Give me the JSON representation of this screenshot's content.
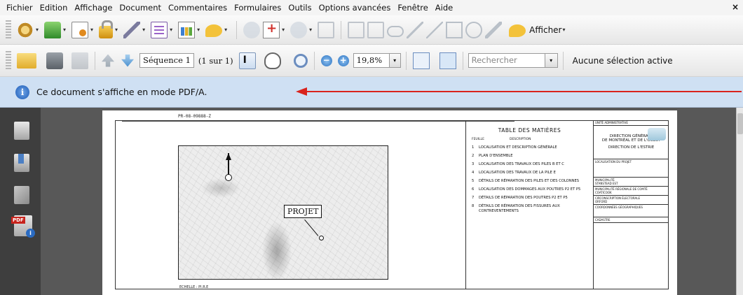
{
  "menu": {
    "items": [
      "Fichier",
      "Edition",
      "Affichage",
      "Document",
      "Commentaires",
      "Formulaires",
      "Outils",
      "Options avancées",
      "Fenêtre",
      "Aide"
    ],
    "close": "×"
  },
  "toolbar1": {
    "afficher_label": "Afficher"
  },
  "toolbar2": {
    "page_field": "Séquence 1",
    "page_of": "(1 sur 1)",
    "zoom_value": "19,8%",
    "search_placeholder": "Rechercher",
    "selection_status": "Aucune sélection active"
  },
  "infobar": {
    "message": "Ce document s'affiche en mode PDF/A."
  },
  "accent_colors": {
    "infobar_bg": "#cfe0f3",
    "arrow": "#d9231c",
    "nav_bg": "#3e3e3e",
    "doc_bg": "#585858"
  },
  "document": {
    "ruler_label": "PR-08-09888-Z",
    "projet_label": "PROJET",
    "scale_label": "ECHELLE : PI.R.E",
    "toc": {
      "title": "TABLE DES MATIÈRES",
      "col_sheet": "FEUILLE",
      "col_desc": "DESCRIPTION",
      "rows": [
        {
          "n": "1",
          "d": "LOCALISATION ET DESCRIPTION GÉNÉRALE"
        },
        {
          "n": "2",
          "d": "PLAN D'ENSEMBLE"
        },
        {
          "n": "3",
          "d": "LOCALISATION DES TRAVAUX DES PILES B ET C"
        },
        {
          "n": "4",
          "d": "LOCALISATION DES TRAVAUX DE LA PILE E"
        },
        {
          "n": "5",
          "d": "DÉTAILS DE RÉPARATION DES PILES ET DES COLONNES"
        },
        {
          "n": "6",
          "d": "LOCALISATION DES DOMMAGES AUX POUTRES P2 ET P5"
        },
        {
          "n": "7",
          "d": "DÉTAILS DE RÉPARATION DES POUTRES P2 ET P5"
        },
        {
          "n": "8",
          "d": "DÉTAILS DE RÉPARATION DES FISSURES AUX CONTREVENTEMENTS"
        }
      ]
    },
    "titleblock": {
      "unit_label": "UNITÉ ADMINISTRATIVE",
      "org_line1": "DIRECTION GÉNÉRALE",
      "org_line2": "DE MONTRÉAL ET DE L'OUEST",
      "org_sub": "DIRECTION DE L'ESTRIE",
      "loc_label": "LOCALISATION DU PROJET",
      "muni_label": "MUNICIPALITÉ",
      "muni_value": "STANSTEAD EST",
      "mrc_label": "MUNICIPALITÉ RÉGIONALE DE COMTÉ",
      "mrc_value": "COATICOOK",
      "circ_label": "CIRCONSCRIPTION ÉLECTORALE",
      "circ_value": "ORFORD",
      "geo_label": "COORDONNÉES GÉOGRAPHIQUES",
      "cadastre_label": "CADASTRE"
    }
  }
}
